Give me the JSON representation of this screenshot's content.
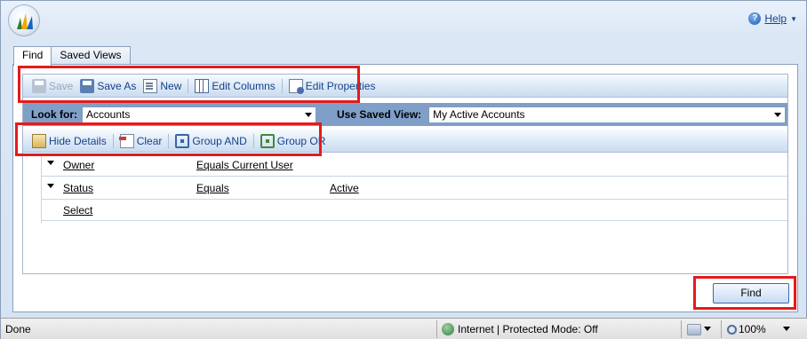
{
  "header": {
    "help_label": "Help"
  },
  "tabs": [
    {
      "label": "Find"
    },
    {
      "label": "Saved Views"
    }
  ],
  "toolbar1": {
    "save": "Save",
    "save_as": "Save As",
    "new": "New",
    "edit_columns": "Edit Columns",
    "edit_properties": "Edit Properties"
  },
  "lookbar": {
    "look_for_label": "Look for:",
    "look_for_value": "Accounts",
    "saved_view_label": "Use Saved View:",
    "saved_view_value": "My Active Accounts"
  },
  "toolbar2": {
    "hide_details": "Hide Details",
    "clear": "Clear",
    "group_and": "Group AND",
    "group_or": "Group OR"
  },
  "criteria": {
    "rows": [
      {
        "field": "Owner",
        "operator": "Equals Current User",
        "value": ""
      },
      {
        "field": "Status",
        "operator": "Equals",
        "value": "Active"
      }
    ],
    "select_label": "Select"
  },
  "find_button": "Find",
  "status": {
    "text": "Done",
    "zone": "Internet | Protected Mode: Off",
    "zoom": "100%"
  },
  "colors": {
    "highlight": "#e31b1b",
    "toolbar_text": "#15428b",
    "lookbar_bg": "#7f9fc9"
  }
}
